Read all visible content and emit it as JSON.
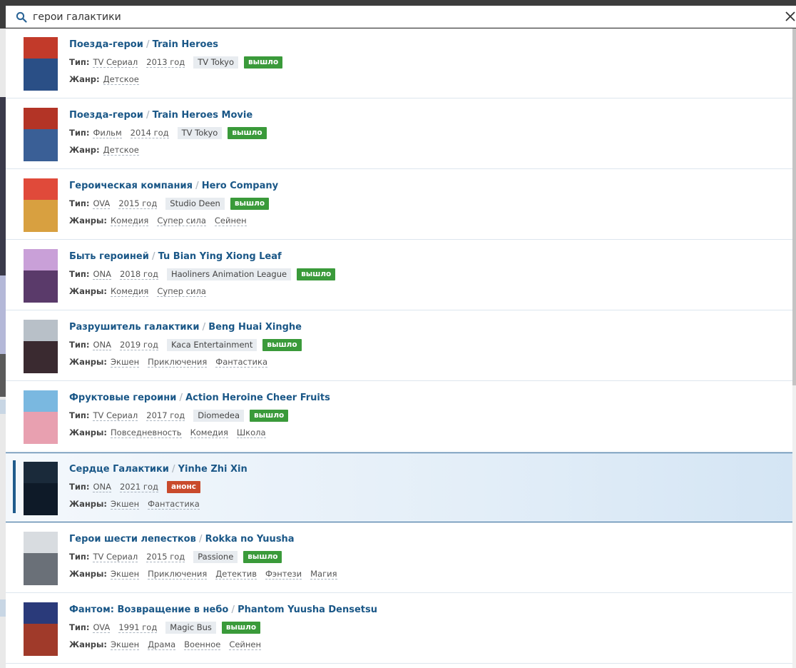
{
  "search": {
    "value": "герои галактики"
  },
  "colors": {
    "released": "#3a9a3a",
    "announce": "#c94a2c",
    "link": "#1a5787"
  },
  "items": [
    {
      "title_ru": "Поезда-герои",
      "title_en": "Train Heroes",
      "type_label": "Тип:",
      "type": "TV Сериал",
      "year": "2013 год",
      "studio": "TV Tokyo",
      "status": "вышло",
      "status_kind": "released",
      "genre_label": "Жанр:",
      "genres": [
        "Детское"
      ],
      "poster": [
        "#c23a2a",
        "#2a4f86"
      ]
    },
    {
      "title_ru": "Поезда-герои",
      "title_en": "Train Heroes Movie",
      "type_label": "Тип:",
      "type": "Фильм",
      "year": "2014 год",
      "studio": "TV Tokyo",
      "status": "вышло",
      "status_kind": "released",
      "genre_label": "Жанр:",
      "genres": [
        "Детское"
      ],
      "poster": [
        "#b33426",
        "#3a5f96"
      ]
    },
    {
      "title_ru": "Героическая компания",
      "title_en": "Hero Company",
      "type_label": "Тип:",
      "type": "OVA",
      "year": "2015 год",
      "studio": "Studio Deen",
      "status": "вышло",
      "status_kind": "released",
      "genre_label": "Жанры:",
      "genres": [
        "Комедия",
        "Супер сила",
        "Сейнен"
      ],
      "poster": [
        "#e04a3a",
        "#d8a040"
      ]
    },
    {
      "title_ru": "Быть героиней",
      "title_en": "Tu Bian Ying Xiong Leaf",
      "type_label": "Тип:",
      "type": "ONA",
      "year": "2018 год",
      "studio": "Haoliners Animation League",
      "status": "вышло",
      "status_kind": "released",
      "genre_label": "Жанры:",
      "genres": [
        "Комедия",
        "Супер сила"
      ],
      "poster": [
        "#c9a0d8",
        "#5a3a6a"
      ]
    },
    {
      "title_ru": "Разрушитель галактики",
      "title_en": "Beng Huai Xinghe",
      "type_label": "Тип:",
      "type": "ONA",
      "year": "2019 год",
      "studio": "Kaca Entertainment",
      "status": "вышло",
      "status_kind": "released",
      "genre_label": "Жанры:",
      "genres": [
        "Экшен",
        "Приключения",
        "Фантастика"
      ],
      "poster": [
        "#b8c0c8",
        "#3a2a30"
      ]
    },
    {
      "title_ru": "Фруктовые героини",
      "title_en": "Action Heroine Cheer Fruits",
      "type_label": "Тип:",
      "type": "TV Сериал",
      "year": "2017 год",
      "studio": "Diomedea",
      "status": "вышло",
      "status_kind": "released",
      "genre_label": "Жанры:",
      "genres": [
        "Повседневность",
        "Комедия",
        "Школа"
      ],
      "poster": [
        "#7ab8e0",
        "#e8a0b0"
      ]
    },
    {
      "title_ru": "Сердце Галактики",
      "title_en": "Yinhe Zhi Xin",
      "type_label": "Тип:",
      "type": "ONA",
      "year": "2021 год",
      "studio": "",
      "status": "анонс",
      "status_kind": "announce",
      "genre_label": "Жанры:",
      "genres": [
        "Экшен",
        "Фантастика"
      ],
      "poster": [
        "#1a2a3a",
        "#0e1a28"
      ]
    },
    {
      "title_ru": "Герои шести лепестков",
      "title_en": "Rokka no Yuusha",
      "type_label": "Тип:",
      "type": "TV Сериал",
      "year": "2015 год",
      "studio": "Passione",
      "status": "вышло",
      "status_kind": "released",
      "genre_label": "Жанры:",
      "genres": [
        "Экшен",
        "Приключения",
        "Детектив",
        "Фэнтези",
        "Магия"
      ],
      "poster": [
        "#d8dce0",
        "#6a7078"
      ]
    },
    {
      "title_ru": "Фантом: Возвращение в небо",
      "title_en": "Phantom Yuusha Densetsu",
      "type_label": "Тип:",
      "type": "OVA",
      "year": "1991 год",
      "studio": "Magic Bus",
      "status": "вышло",
      "status_kind": "released",
      "genre_label": "Жанры:",
      "genres": [
        "Экшен",
        "Драма",
        "Военное",
        "Сейнен"
      ],
      "poster": [
        "#2a3a7a",
        "#a03a2a"
      ]
    }
  ]
}
